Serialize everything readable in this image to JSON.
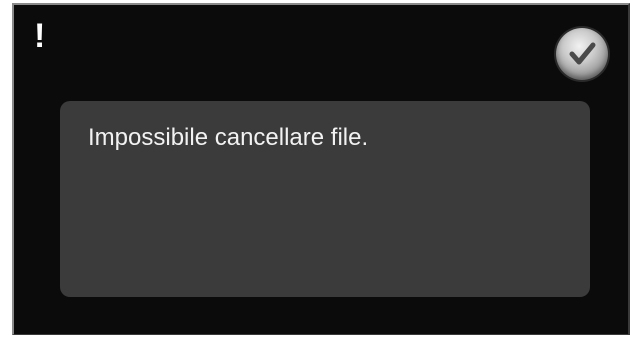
{
  "dialog": {
    "alert_symbol": "!",
    "message": "Impossibile cancellare file.",
    "confirm_icon": "checkmark-icon"
  }
}
